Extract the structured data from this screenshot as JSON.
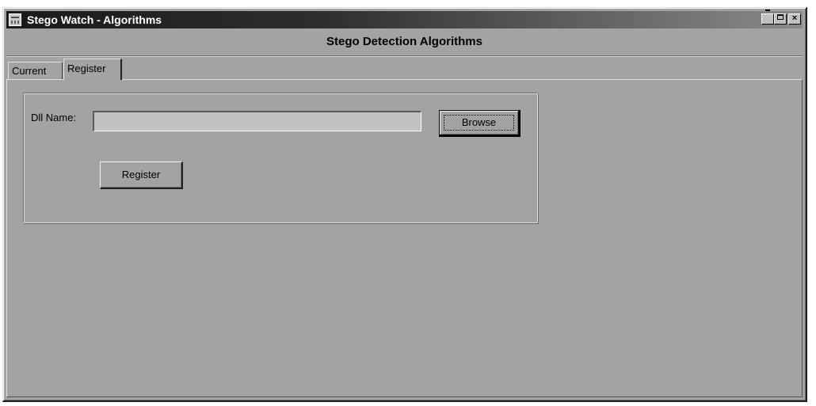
{
  "window": {
    "title": "Stego Watch - Algorithms",
    "controls": {
      "minimize": "_",
      "maximize": "□",
      "close": "×"
    }
  },
  "header": {
    "title": "Stego Detection Algorithms"
  },
  "tabs": [
    {
      "label": "Current",
      "active": false
    },
    {
      "label": "Register",
      "active": true
    }
  ],
  "register_panel": {
    "dll_label": "Dll Name:",
    "dll_value": "",
    "browse_label": "Browse",
    "register_label": "Register"
  }
}
